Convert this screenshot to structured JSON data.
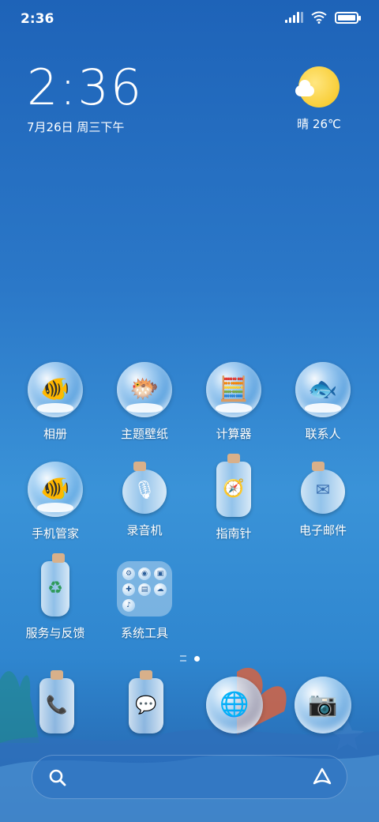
{
  "status_bar": {
    "time": "2:36",
    "battery_level": 1.0
  },
  "clock_widget": {
    "time": "2:36",
    "date": "7月26日 周三下午"
  },
  "weather_widget": {
    "text": "晴 26℃",
    "icon": "sunny-cloud-icon"
  },
  "apps": [
    {
      "label": "相册",
      "icon": "fish-bubble-icon",
      "glyph": "🐠"
    },
    {
      "label": "主题壁纸",
      "icon": "yellow-fish-bubble-icon",
      "glyph": "🐡"
    },
    {
      "label": "计算器",
      "icon": "calculator-bubble-icon",
      "glyph": "🧮"
    },
    {
      "label": "联系人",
      "icon": "fish-school-bubble-icon",
      "glyph": "🐟"
    },
    {
      "label": "手机管家",
      "icon": "goldfish-bubble-icon",
      "glyph": "🐠"
    },
    {
      "label": "录音机",
      "icon": "recorder-bottle-icon",
      "glyph": "🎙"
    },
    {
      "label": "指南针",
      "icon": "compass-bottle-icon",
      "glyph": "🧭"
    },
    {
      "label": "电子邮件",
      "icon": "email-bottle-icon",
      "glyph": "✉"
    },
    {
      "label": "服务与反馈",
      "icon": "service-bottle-icon",
      "glyph": "♻"
    },
    {
      "label": "系统工具",
      "icon": "system-tools-folder-icon",
      "glyph": ""
    }
  ],
  "folder_minis": [
    "⚙",
    "◉",
    "▣",
    "✚",
    "▤",
    "☁",
    "♪"
  ],
  "dock": [
    {
      "name": "phone",
      "icon": "phone-bottle-icon",
      "glyph": "📞"
    },
    {
      "name": "messages",
      "icon": "messages-bottle-icon",
      "glyph": "💬"
    },
    {
      "name": "browser",
      "icon": "browser-bubble-icon",
      "glyph": "🌐"
    },
    {
      "name": "camera",
      "icon": "camera-bubble-icon",
      "glyph": "📷"
    }
  ]
}
